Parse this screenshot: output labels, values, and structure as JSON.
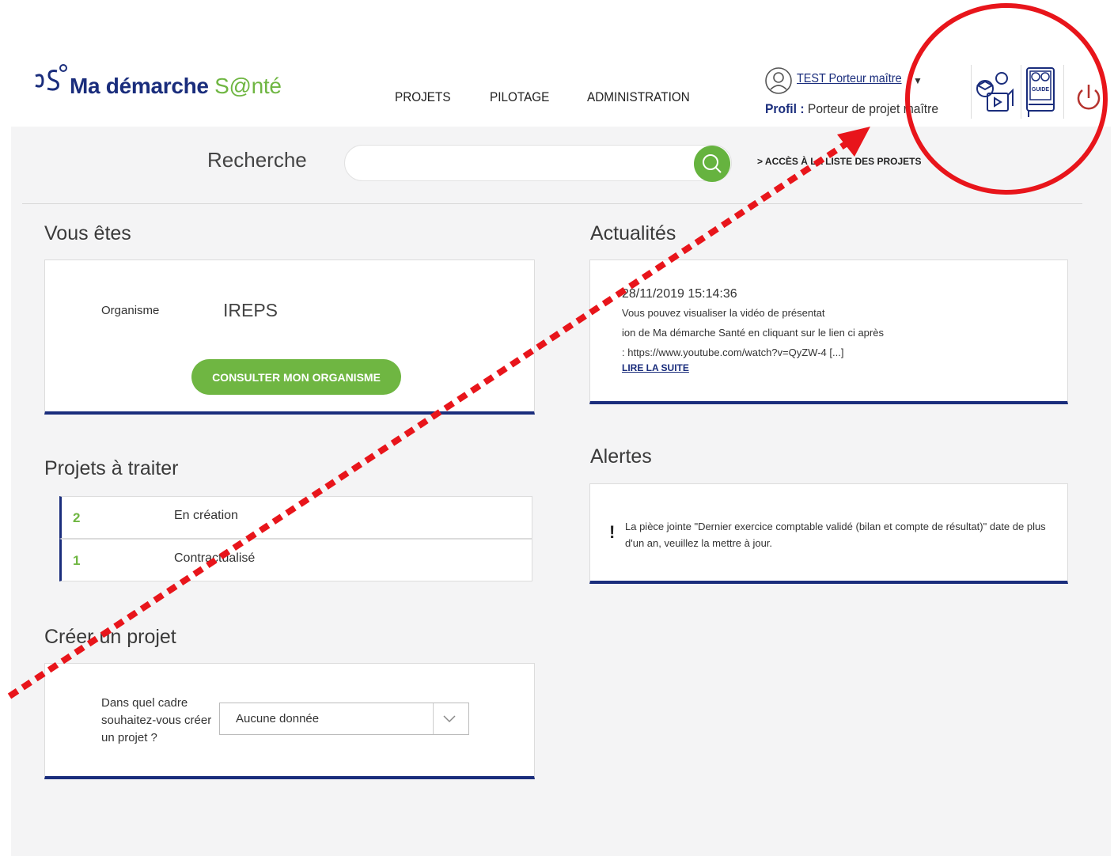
{
  "brand": {
    "name_part1": "Ma démarche ",
    "name_part2": "S@nté"
  },
  "nav": {
    "items": [
      "PROJETS",
      "PILOTAGE",
      "ADMINISTRATION"
    ]
  },
  "user": {
    "name": "TEST Porteur maître",
    "profile_label": "Profil :",
    "profile_value": "Porteur de projet maître"
  },
  "header_icons": [
    "training-video-icon",
    "guide-book-icon",
    "power-icon"
  ],
  "search": {
    "label": "Recherche",
    "placeholder": "",
    "list_link": "> ACCÈS À LA LISTE DES PROJETS"
  },
  "vous_etes": {
    "title": "Vous êtes",
    "org_label": "Organisme",
    "org_value": "IREPS",
    "button": "CONSULTER MON ORGANISME"
  },
  "actualites": {
    "title": "Actualités",
    "date": "28/11/2019 15:14:36",
    "lines": [
      "Vous pouvez visualiser la vidéo de présentat",
      "ion de Ma démarche Santé en cliquant sur le lien ci après",
      ": https://www.youtube.com/watch?v=QyZW-4 [...]"
    ],
    "more": "LIRE LA SUITE"
  },
  "alertes": {
    "title": "Alertes",
    "icon": "!",
    "text": "La pièce jointe \"Dernier exercice comptable validé (bilan et compte de résultat)\" date de plus d'un an, veuillez la mettre à jour."
  },
  "projets": {
    "title": "Projets à traiter",
    "rows": [
      {
        "count": "2",
        "label": "En création"
      },
      {
        "count": "1",
        "label": "Contractualisé"
      }
    ]
  },
  "creer": {
    "title": "Créer un projet",
    "question": "Dans quel cadre souhaitez-vous créer un projet ?",
    "select_value": "Aucune donnée"
  },
  "colors": {
    "navy": "#1a2d7c",
    "green": "#6fb642",
    "annotation_red": "#e8151b",
    "power": "#b5332e"
  }
}
